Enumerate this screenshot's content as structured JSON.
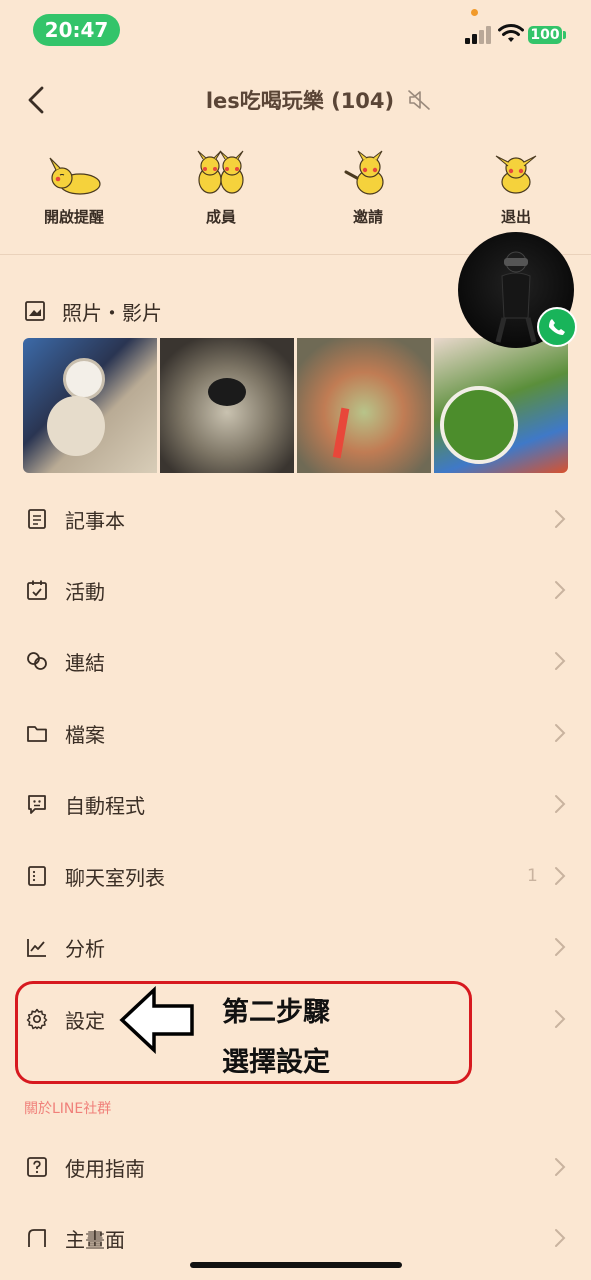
{
  "status_bar": {
    "time": "20:47",
    "battery": "100"
  },
  "header": {
    "title": "les吃喝玩樂 (104)"
  },
  "actions": [
    {
      "label": "開啟提醒",
      "icon": "pikachu-lying-icon"
    },
    {
      "label": "成員",
      "icon": "pikachu-pair-icon"
    },
    {
      "label": "邀請",
      "icon": "pikachu-wave-icon"
    },
    {
      "label": "退出",
      "icon": "pikachu-leave-icon"
    }
  ],
  "photos": {
    "title": "照片・影片"
  },
  "menu": [
    {
      "label": "記事本",
      "icon": "notebook-icon"
    },
    {
      "label": "活動",
      "icon": "calendar-icon"
    },
    {
      "label": "連結",
      "icon": "link-icon"
    },
    {
      "label": "檔案",
      "icon": "folder-icon"
    },
    {
      "label": "自動程式",
      "icon": "bot-icon"
    },
    {
      "label": "聊天室列表",
      "icon": "list-icon",
      "count": "1"
    },
    {
      "label": "分析",
      "icon": "chart-icon"
    },
    {
      "label": "設定",
      "icon": "gear-icon"
    }
  ],
  "about_caption": "關於LINE社群",
  "about_menu": [
    {
      "label": "使用指南",
      "icon": "help-icon"
    },
    {
      "label": "主畫面",
      "icon": "home-icon"
    }
  ],
  "annotation": {
    "line1": "第二步驟",
    "line2": "選擇設定"
  },
  "colors": {
    "background": "#fbe7d2",
    "accent_green": "#33c46a",
    "annotation_red": "#d7191f"
  }
}
